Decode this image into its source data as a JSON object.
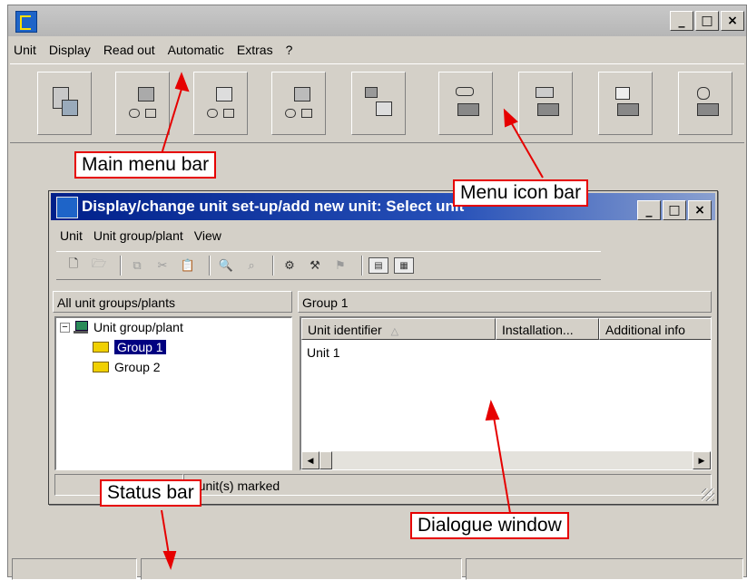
{
  "main_menu": [
    "Unit",
    "Display",
    "Read out",
    "Automatic",
    "Extras",
    "?"
  ],
  "window_controls": [
    "_",
    "□",
    "×"
  ],
  "toolbar_icons": [
    "unit-overview-icon",
    "unit-setup-1-icon",
    "unit-setup-2-icon",
    "unit-setup-3-icon",
    "transfer-icon",
    "folder-open-1-icon",
    "folder-open-2-icon",
    "folder-open-3-icon",
    "folder-open-4-icon"
  ],
  "callouts": {
    "main_menu_bar": "Main menu bar",
    "menu_icon_bar": "Menu icon bar",
    "status_bar": "Status bar",
    "dialogue_window": "Dialogue window"
  },
  "dialog": {
    "title": "Display/change unit set-up/add new unit: Select unit",
    "menu": [
      "Unit",
      "Unit group/plant",
      "View"
    ],
    "left_pane_header": "All unit groups/plants",
    "right_pane_header": "Group 1",
    "tree": {
      "root": "Unit group/plant",
      "root_toggle": "−",
      "children": [
        "Group 1",
        "Group 2"
      ]
    },
    "columns": [
      "Unit identifier",
      "Installation...",
      "Additional info"
    ],
    "rows": [
      "Unit 1"
    ],
    "status_text": "1 unit(s) marked"
  }
}
